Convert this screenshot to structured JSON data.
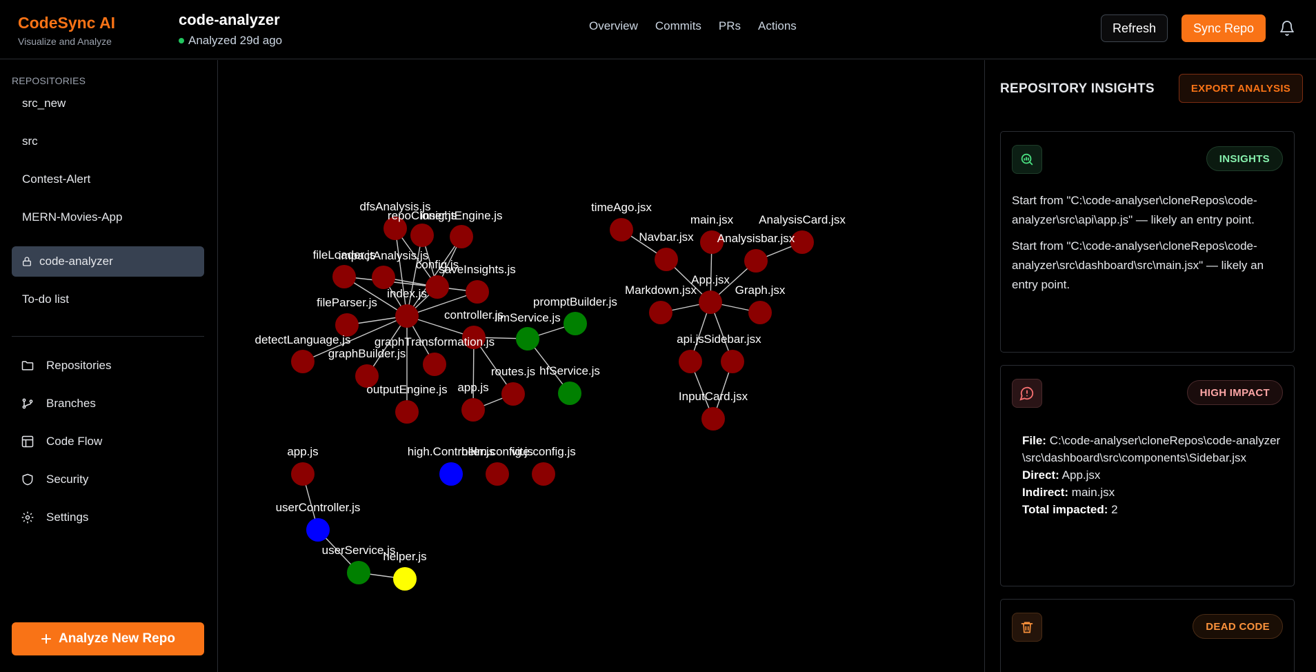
{
  "header": {
    "brand": "CodeSync AI",
    "brand_sub": "Visualize and Analyze",
    "repo_name": "code-analyzer",
    "status": "Analyzed 29d ago",
    "nav": [
      "Overview",
      "Commits",
      "PRs",
      "Actions"
    ],
    "refresh_label": "Refresh",
    "sync_label": "Sync Repo"
  },
  "sidebar": {
    "section_label": "REPOSITORIES",
    "repos": [
      "src_new",
      "src",
      "Contest-Alert",
      "MERN-Movies-App",
      "code-analyzer",
      "To-do list"
    ],
    "active_repo": "code-analyzer",
    "nav": [
      {
        "label": "Repositories",
        "icon": "folder-icon"
      },
      {
        "label": "Branches",
        "icon": "branch-icon"
      },
      {
        "label": "Code Flow",
        "icon": "layout-icon"
      },
      {
        "label": "Security",
        "icon": "shield-icon"
      },
      {
        "label": "Settings",
        "icon": "gear-icon"
      }
    ],
    "analyze_label": "Analyze New Repo"
  },
  "graph": {
    "colors": {
      "red": "#8b0000",
      "green": "#008000",
      "blue": "#0000ff",
      "yellow": "#ffff00",
      "edge": "#cccccc"
    },
    "nodes": [
      {
        "id": "dfs",
        "label": "dfsAnalysis.js",
        "color": "red"
      },
      {
        "id": "repoClone",
        "label": "repoCloner.js",
        "color": "red"
      },
      {
        "id": "insight",
        "label": "insightEngine.js",
        "color": "red"
      },
      {
        "id": "fileLoader",
        "label": "fileLoader.js",
        "color": "red"
      },
      {
        "id": "impact",
        "label": "impactAnalysis.js",
        "color": "red"
      },
      {
        "id": "config",
        "label": "config.js",
        "color": "red"
      },
      {
        "id": "saveInsights",
        "label": "saveInsights.js",
        "color": "red"
      },
      {
        "id": "index",
        "label": "index.js",
        "color": "red"
      },
      {
        "id": "fileParser",
        "label": "fileParser.js",
        "color": "red"
      },
      {
        "id": "controller",
        "label": "controller.js",
        "color": "red"
      },
      {
        "id": "llm",
        "label": "llmService.js",
        "color": "green"
      },
      {
        "id": "prompt",
        "label": "promptBuilder.js",
        "color": "green"
      },
      {
        "id": "detect",
        "label": "detectLanguage.js",
        "color": "red"
      },
      {
        "id": "graphBuilder",
        "label": "graphBuilder.js",
        "color": "red"
      },
      {
        "id": "graphTrans",
        "label": "graphTransformation.js",
        "color": "red"
      },
      {
        "id": "routes",
        "label": "routes.js",
        "color": "red"
      },
      {
        "id": "hf",
        "label": "hfService.js",
        "color": "green"
      },
      {
        "id": "output",
        "label": "outputEngine.js",
        "color": "red"
      },
      {
        "id": "app1",
        "label": "app.js",
        "color": "red"
      },
      {
        "id": "timeAgo",
        "label": "timeAgo.jsx",
        "color": "red"
      },
      {
        "id": "navbar",
        "label": "Navbar.jsx",
        "color": "red"
      },
      {
        "id": "main",
        "label": "main.jsx",
        "color": "red"
      },
      {
        "id": "analysisCard",
        "label": "AnalysisCard.jsx",
        "color": "red"
      },
      {
        "id": "analysisbar",
        "label": "Analysisbar.jsx",
        "color": "red"
      },
      {
        "id": "appjsx",
        "label": "App.jsx",
        "color": "red"
      },
      {
        "id": "markdown",
        "label": "Markdown.jsx",
        "color": "red"
      },
      {
        "id": "graphjsx",
        "label": "Graph.jsx",
        "color": "red"
      },
      {
        "id": "api",
        "label": "api.js",
        "color": "red"
      },
      {
        "id": "sidebar",
        "label": "Sidebar.jsx",
        "color": "red"
      },
      {
        "id": "inputCard",
        "label": "InputCard.jsx",
        "color": "red"
      },
      {
        "id": "highCtrl",
        "label": "high.Controller.js",
        "color": "blue"
      },
      {
        "id": "helmConfig",
        "label": "helm.config.js",
        "color": "red"
      },
      {
        "id": "viteConfig",
        "label": "vite.config.js",
        "color": "red"
      },
      {
        "id": "app2",
        "label": "app.js",
        "color": "red"
      },
      {
        "id": "userCtrl",
        "label": "userController.js",
        "color": "blue"
      },
      {
        "id": "userSvc",
        "label": "userService.js",
        "color": "green"
      },
      {
        "id": "helper",
        "label": "helper.js",
        "color": "yellow"
      }
    ]
  },
  "panel": {
    "title": "REPOSITORY INSIGHTS",
    "export_label": "EXPORT ANALYSIS",
    "insights": {
      "badge": "INSIGHTS",
      "lines": [
        "Start from \"C:\\code-analyser\\cloneRepos\\code-analyzer\\src\\api\\app.js\" — likely an entry point.",
        "Start from \"C:\\code-analyser\\cloneRepos\\code-analyzer\\src\\dashboard\\src\\main.jsx\" — likely an entry point."
      ]
    },
    "impact": {
      "badge": "HIGH IMPACT",
      "file_label": "File:",
      "file": "C:\\code-analyser\\cloneRepos\\code-analyzer\\src\\dashboard\\src\\components\\Sidebar.jsx",
      "direct_label": "Direct:",
      "direct": "App.jsx",
      "indirect_label": "Indirect:",
      "indirect": "main.jsx",
      "total_label": "Total impacted:",
      "total": "2"
    },
    "dead": {
      "badge": "DEAD CODE"
    }
  }
}
